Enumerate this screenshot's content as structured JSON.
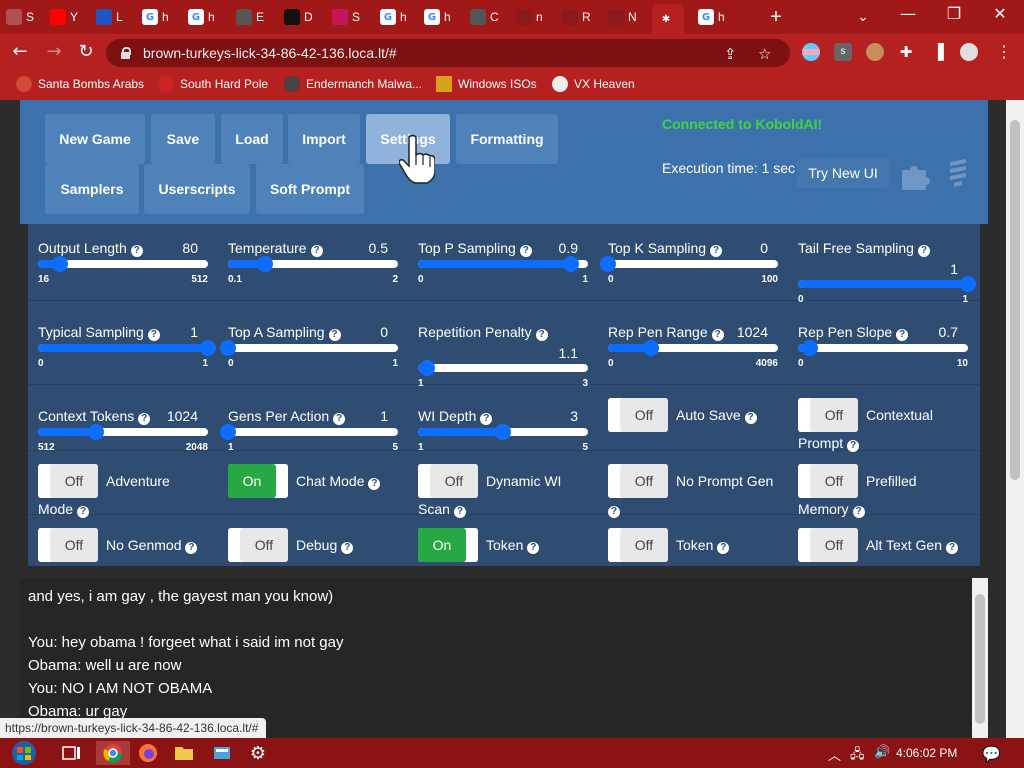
{
  "browser": {
    "tabs": [
      {
        "letter": "S",
        "icon": "web-favicon",
        "color": "#b05050"
      },
      {
        "letter": "Y",
        "icon": "youtube-icon",
        "color": "#ff0000"
      },
      {
        "letter": "L",
        "icon": "library-icon",
        "color": "#2056c4"
      },
      {
        "letter": "h",
        "icon": "google-icon",
        "color": "#ffffff"
      },
      {
        "letter": "h",
        "icon": "google-icon",
        "color": "#ffffff"
      },
      {
        "letter": "E",
        "icon": "globe-icon",
        "color": "#555555"
      },
      {
        "letter": "D",
        "icon": "ae-icon",
        "color": "#111111"
      },
      {
        "letter": "S",
        "icon": "sb-icon",
        "color": "#c2185b"
      },
      {
        "letter": "h",
        "icon": "google-icon",
        "color": "#ffffff"
      },
      {
        "letter": "h",
        "icon": "google-icon",
        "color": "#ffffff"
      },
      {
        "letter": "C",
        "icon": "globe-icon",
        "color": "#555555"
      },
      {
        "letter": "n",
        "icon": "web-favicon",
        "color": "#8a1a1a"
      },
      {
        "letter": "R",
        "icon": "reddit-icon",
        "color": "#8a1a1a"
      },
      {
        "letter": "N",
        "icon": "web-favicon",
        "color": "#8a1a1a"
      },
      {
        "letter": "",
        "icon": "koboldai-icon",
        "color": "#b52020"
      },
      {
        "letter": "h",
        "icon": "google-icon",
        "color": "#ffffff"
      }
    ],
    "new_tab": "+",
    "url": "brown-turkeys-lick-34-86-42-136.loca.lt/#",
    "bookmarks": [
      {
        "label": "Santa Bombs Arabs",
        "color": "#d24a3a"
      },
      {
        "label": "South Hard Pole",
        "color": "#cc2222"
      },
      {
        "label": "Endermanch Malwa...",
        "color": "#444444"
      },
      {
        "label": "Windows ISOs",
        "color": "#d9a21a"
      },
      {
        "label": "VX Heaven",
        "color": "#eeeeee"
      }
    ],
    "status_url": "https://brown-turkeys-lick-34-86-42-136.loca.lt/#"
  },
  "topbar": {
    "buttons": [
      "New Game",
      "Save",
      "Load",
      "Import",
      "Settings",
      "Formatting",
      "Samplers",
      "Userscripts",
      "Soft Prompt"
    ],
    "connected": "Connected to KoboldAI!",
    "execution": "Execution time: 1 sec",
    "try_new_ui": "Try New UI"
  },
  "sliders": [
    {
      "label": "Output Length",
      "value": "80",
      "min": "16",
      "max": "512",
      "frac": 0.13
    },
    {
      "label": "Temperature",
      "value": "0.5",
      "min": "0.1",
      "max": "2",
      "frac": 0.22
    },
    {
      "label": "Top P Sampling",
      "value": "0.9",
      "min": "0",
      "max": "1",
      "frac": 0.9
    },
    {
      "label": "Top K Sampling",
      "value": "0",
      "min": "0",
      "max": "100",
      "frac": 0.0
    },
    {
      "label": "Tail Free Sampling",
      "value": "1",
      "min": "0",
      "max": "1",
      "frac": 1.0
    },
    {
      "label": "Typical Sampling",
      "value": "1",
      "min": "0",
      "max": "1",
      "frac": 1.0
    },
    {
      "label": "Top A Sampling",
      "value": "0",
      "min": "0",
      "max": "1",
      "frac": 0.0
    },
    {
      "label": "Repetition Penalty",
      "value": "1.1",
      "min": "1",
      "max": "3",
      "frac": 0.05
    },
    {
      "label": "Rep Pen Range",
      "value": "1024",
      "min": "0",
      "max": "4096",
      "frac": 0.25
    },
    {
      "label": "Rep Pen Slope",
      "value": "0.7",
      "min": "0",
      "max": "10",
      "frac": 0.07
    },
    {
      "label": "Context Tokens",
      "value": "1024",
      "min": "512",
      "max": "2048",
      "frac": 0.34
    },
    {
      "label": "Gens Per Action",
      "value": "1",
      "min": "1",
      "max": "5",
      "frac": 0.0
    },
    {
      "label": "WI Depth",
      "value": "3",
      "min": "1",
      "max": "5",
      "frac": 0.5
    }
  ],
  "toggles": [
    {
      "label": "Auto Save",
      "line2": "",
      "state": "Off"
    },
    {
      "label": "Contextual",
      "line2": "Prompt",
      "state": "Off"
    },
    {
      "label": "Adventure",
      "line2": "Mode",
      "state": "Off"
    },
    {
      "label": "Chat Mode",
      "line2": "",
      "state": "On"
    },
    {
      "label": "Dynamic WI",
      "line2": "Scan",
      "state": "Off"
    },
    {
      "label": "No Prompt Gen",
      "line2": "",
      "state": "Off"
    },
    {
      "label": "Prefilled",
      "line2": "Memory",
      "state": "Off"
    },
    {
      "label": "No Genmod",
      "line2": "",
      "state": "Off"
    },
    {
      "label": "Debug",
      "line2": "",
      "state": "Off"
    },
    {
      "label": "Token",
      "line2": "",
      "state": "On"
    },
    {
      "label": "Token",
      "line2": "",
      "state": "Off"
    },
    {
      "label": "Alt Text Gen",
      "line2": "",
      "state": "Off"
    }
  ],
  "story": [
    "and yes, i am gay , the gayest man you know)",
    "",
    "You: hey obama ! forgeet what i said im not gay",
    "Obama: well u are now",
    "You: NO I AM NOT OBAMA",
    "Obama: ur gay"
  ],
  "taskbar": {
    "clock": "4:06:02 PM"
  },
  "colors": {
    "chrome": "#b52020",
    "topbar": "#3d71ac",
    "settings": "#2f4d72",
    "slider": "#0d6efd",
    "toggle_on": "#28a745",
    "connected": "#3cd63c"
  }
}
